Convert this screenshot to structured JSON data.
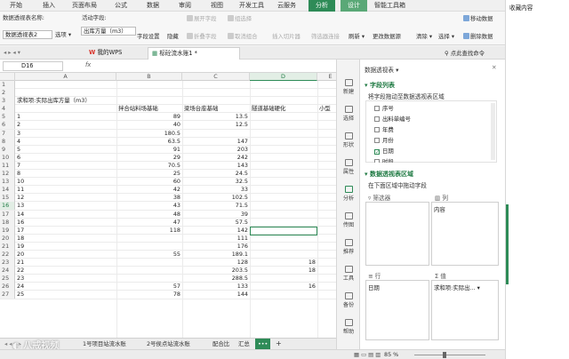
{
  "ribbon_tabs": [
    "开始",
    "插入",
    "页面布局",
    "公式",
    "数据",
    "审阅",
    "视图",
    "开发工具",
    "云服务",
    "分析",
    "设计",
    "智能工具箱"
  ],
  "ribbon": {
    "name_label": "数据透视表名称:",
    "name_value": "数据透视表2",
    "options": "选项",
    "active_field_label": "活动字段:",
    "active_field_value": "出库方量（m3）",
    "field_settings": "字段设置",
    "hide": "隐藏",
    "expand_field": "展开字段",
    "collapse_field": "折叠字段",
    "group_selection": "组选择",
    "ungroup": "取消组合",
    "insert_slicer": "插入切片器",
    "filter_conn": "筛选器连接",
    "refresh": "刷新",
    "change_source": "更改数据源",
    "clear": "清除",
    "select": "选择",
    "move_pivot": "移动数据",
    "delete_pivot": "删除数据"
  },
  "file_tabs": {
    "wps": "我的WPS",
    "doc": "标砼流水账1 *",
    "search": "点此查找命令"
  },
  "formula_bar": {
    "cell_ref": "D16",
    "fx": "fx",
    "value": ""
  },
  "columns": [
    "A",
    "B",
    "C",
    "D",
    "E"
  ],
  "sheet": {
    "a3": "求和项:实际出库方量（m3）",
    "b4": "拌合站料场基础",
    "c4": "梁场台座基础",
    "d4": "隧道基础硬化",
    "e4": "小型",
    "rows": [
      {
        "n": "1",
        "a": "",
        "b": "",
        "c": "",
        "d": ""
      },
      {
        "n": "2",
        "a": "",
        "b": "",
        "c": "",
        "d": ""
      },
      {
        "n": "3",
        "a": "求和项:实际出库方量（m3）",
        "b": "",
        "c": "",
        "d": ""
      },
      {
        "n": "4",
        "a": "",
        "b": "拌合站料场基础",
        "c": "梁场台座基础",
        "d": "隧道基础硬化",
        "e": "小型"
      },
      {
        "n": "5",
        "a": "1",
        "b": "89",
        "c": "13.5",
        "d": ""
      },
      {
        "n": "6",
        "a": "2",
        "b": "40",
        "c": "12.5",
        "d": ""
      },
      {
        "n": "7",
        "a": "3",
        "b": "180.5",
        "c": "",
        "d": ""
      },
      {
        "n": "8",
        "a": "4",
        "b": "63.5",
        "c": "147",
        "d": ""
      },
      {
        "n": "9",
        "a": "5",
        "b": "91",
        "c": "203",
        "d": ""
      },
      {
        "n": "10",
        "a": "6",
        "b": "29",
        "c": "242",
        "d": ""
      },
      {
        "n": "11",
        "a": "7",
        "b": "70.5",
        "c": "143",
        "d": ""
      },
      {
        "n": "12",
        "a": "8",
        "b": "25",
        "c": "24.5",
        "d": ""
      },
      {
        "n": "13",
        "a": "10",
        "b": "60",
        "c": "32.5",
        "d": ""
      },
      {
        "n": "14",
        "a": "11",
        "b": "42",
        "c": "33",
        "d": ""
      },
      {
        "n": "15",
        "a": "12",
        "b": "38",
        "c": "102.5",
        "d": ""
      },
      {
        "n": "16",
        "a": "13",
        "b": "43",
        "c": "71.5",
        "d": ""
      },
      {
        "n": "17",
        "a": "14",
        "b": "48",
        "c": "39",
        "d": ""
      },
      {
        "n": "18",
        "a": "16",
        "b": "47",
        "c": "57.5",
        "d": ""
      },
      {
        "n": "19",
        "a": "17",
        "b": "118",
        "c": "142",
        "d": ""
      },
      {
        "n": "20",
        "a": "18",
        "b": "",
        "c": "111",
        "d": ""
      },
      {
        "n": "21",
        "a": "19",
        "b": "",
        "c": "176",
        "d": ""
      },
      {
        "n": "22",
        "a": "20",
        "b": "55",
        "c": "189.1",
        "d": ""
      },
      {
        "n": "23",
        "a": "21",
        "b": "",
        "c": "128",
        "d": "18"
      },
      {
        "n": "24",
        "a": "22",
        "b": "",
        "c": "203.5",
        "d": "18"
      },
      {
        "n": "25",
        "a": "23",
        "b": "",
        "c": "288.5",
        "d": ""
      },
      {
        "n": "26",
        "a": "24",
        "b": "57",
        "c": "133",
        "d": "16"
      },
      {
        "n": "27",
        "a": "25",
        "b": "78",
        "c": "144",
        "d": ""
      }
    ]
  },
  "sheet_tabs": [
    "1号项目站流水账",
    "2号侯点站流水账",
    "配合比",
    "汇总"
  ],
  "status": {
    "zoom": "85 %"
  },
  "vtools": [
    "新建",
    "选择",
    "形状",
    "属性",
    "分析",
    "传图",
    "推荐",
    "工具",
    "备份",
    "帮助"
  ],
  "pivot": {
    "title": "数据透视表",
    "field_list": "字段列表",
    "drag_hint": "将字段拖动至数据透视表区域",
    "fields": [
      {
        "label": "序号",
        "checked": false
      },
      {
        "label": "出料单编号",
        "checked": false
      },
      {
        "label": "年费",
        "checked": false
      },
      {
        "label": "月份",
        "checked": false
      },
      {
        "label": "日期",
        "checked": true
      },
      {
        "label": "时段",
        "checked": false
      }
    ],
    "areas_title": "数据透视表区域",
    "areas_hint": "在下面区域中拖动字段",
    "filter_label": "筛选器",
    "col_label": "列",
    "col_item": "内容",
    "row_label": "行",
    "row_item": "日期",
    "val_label": "值",
    "val_item": "求和项:实际出..."
  },
  "right_panel": {
    "title": "收藏内容"
  },
  "watermark": "八戒视频"
}
